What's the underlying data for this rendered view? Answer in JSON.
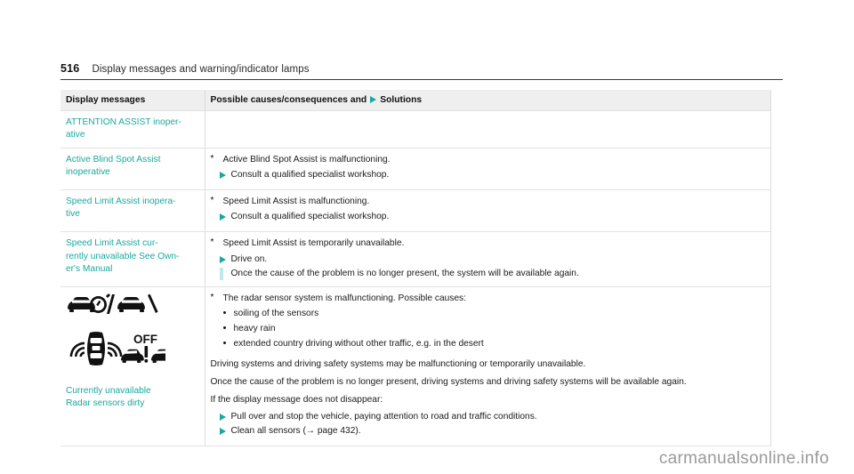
{
  "header": {
    "page_number": "516",
    "title": "Display messages and warning/indicator lamps"
  },
  "table": {
    "columns": {
      "messages": "Display messages",
      "causes_prefix": "Possible causes/consequences and",
      "causes_suffix": "Solutions",
      "solution_marker_icon": "solution-triangle-icon"
    },
    "rows": [
      {
        "message_lines": [
          "ATTENTION ASSIST inoper-",
          "ative"
        ],
        "cause": "",
        "solutions": []
      },
      {
        "message_lines": [
          "Active Blind Spot Assist",
          "inoperative"
        ],
        "cause": "Active Blind Spot Assist is malfunctioning.",
        "solutions": [
          "Consult a qualified specialist workshop."
        ]
      },
      {
        "message_lines": [
          "Speed Limit Assist inopera-",
          "tive"
        ],
        "cause": "Speed Limit Assist is malfunctioning.",
        "solutions": [
          "Consult a qualified specialist workshop."
        ]
      },
      {
        "message_lines": [
          "Speed Limit Assist cur-",
          "rently unavailable See Own-",
          "er's Manual"
        ],
        "cause": "Speed Limit Assist is temporarily unavailable.",
        "solutions": [
          "Drive on."
        ],
        "solution_continuation": "Once the cause of the problem is no longer present, the system will be available again."
      },
      {
        "icons": [
          "car-speedometer-slash-car-icon",
          "radar-car-off-warning-icon"
        ],
        "caption_lines": [
          "Currently unavailable",
          "Radar sensors dirty"
        ],
        "cause": "The radar sensor system is malfunctioning. Possible causes:",
        "bullets": [
          "soiling of the sensors",
          "heavy rain",
          "extended country driving without other traffic, e.g. in the desert"
        ],
        "paragraphs": [
          "Driving systems and driving safety systems may be malfunctioning or temporarily unavailable.",
          "Once the cause of the problem is no longer present, driving systems and driving safety systems will be available again.",
          "If the display message does not disappear:"
        ],
        "solutions": [
          "Pull over and stop the vehicle, paying attention to road and traffic conditions.",
          "Clean all sensors (→ page 432)."
        ]
      }
    ]
  },
  "watermark": "carmanualsonline.info",
  "colors": {
    "accent_teal": "#1aa8a0",
    "accent_teal_light": "#bfe9e6",
    "header_bg": "#efefef",
    "watermark_gray": "#9a9a9a"
  }
}
